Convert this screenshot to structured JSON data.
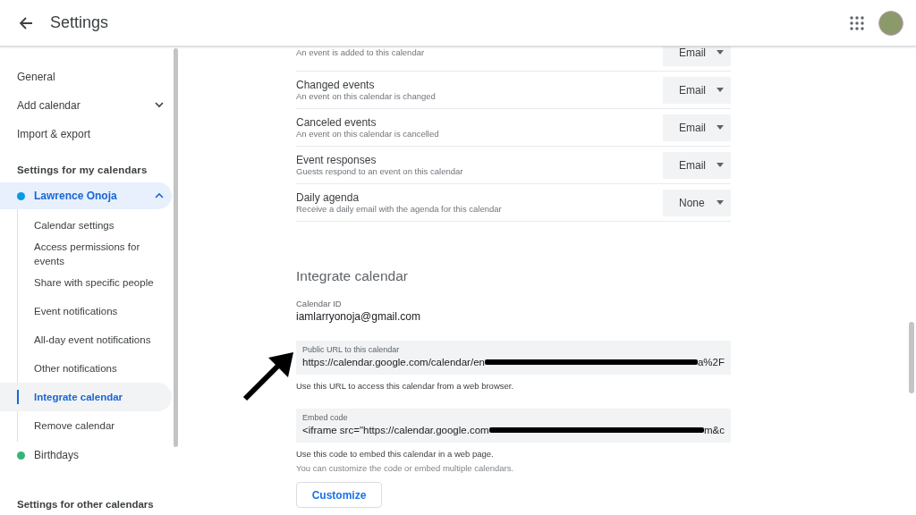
{
  "header": {
    "title": "Settings"
  },
  "sidebar": {
    "top_items": [
      {
        "kind": "link",
        "label": "General"
      },
      {
        "kind": "expander",
        "label": "Add calendar",
        "expanded": false
      },
      {
        "kind": "link",
        "label": "Import & export"
      }
    ],
    "my_calendars_heading": "Settings for my calendars",
    "calendars": [
      {
        "name": "Lawrence Onoja",
        "color": "#039be5",
        "expanded": true,
        "children": [
          {
            "label": "Calendar settings",
            "selected": false
          },
          {
            "label": "Access permissions for events",
            "selected": false
          },
          {
            "label": "Share with specific people",
            "selected": false
          },
          {
            "label": "Event notifications",
            "selected": false
          },
          {
            "label": "All-day event notifications",
            "selected": false
          },
          {
            "label": "Other notifications",
            "selected": false
          },
          {
            "label": "Integrate calendar",
            "selected": true
          },
          {
            "label": "Remove calendar",
            "selected": false
          }
        ]
      },
      {
        "name": "Birthdays",
        "color": "#33b679",
        "expanded": false
      }
    ],
    "other_calendars_heading": "Settings for other calendars"
  },
  "notifications": [
    {
      "description": "An event is added to this calendar",
      "value": "Email"
    },
    {
      "title": "Changed events",
      "description": "An event on this calendar is changed",
      "value": "Email"
    },
    {
      "title": "Canceled events",
      "description": "An event on this calendar is cancelled",
      "value": "Email"
    },
    {
      "title": "Event responses",
      "description": "Guests respond to an event on this calendar",
      "value": "Email"
    },
    {
      "title": "Daily agenda",
      "description": "Receive a daily email with the agenda for this calendar",
      "value": "None"
    }
  ],
  "integrate": {
    "title": "Integrate calendar",
    "calendar_id": {
      "label": "Calendar ID",
      "value": "iamlarryonoja@gmail.com"
    },
    "public_url": {
      "label": "Public URL to this calendar",
      "value_start": "https://calendar.google.com/calendar/en",
      "value_end": "a%2F",
      "help": "Use this URL to access this calendar from a web browser."
    },
    "embed_code": {
      "label": "Embed code",
      "value_start": "<iframe src=\"https://calendar.google.com",
      "value_end": "m&c",
      "help": "Use this code to embed this calendar in a web page.",
      "hint": "You can customize the code or embed multiple calendars."
    },
    "customize_button": "Customize"
  }
}
